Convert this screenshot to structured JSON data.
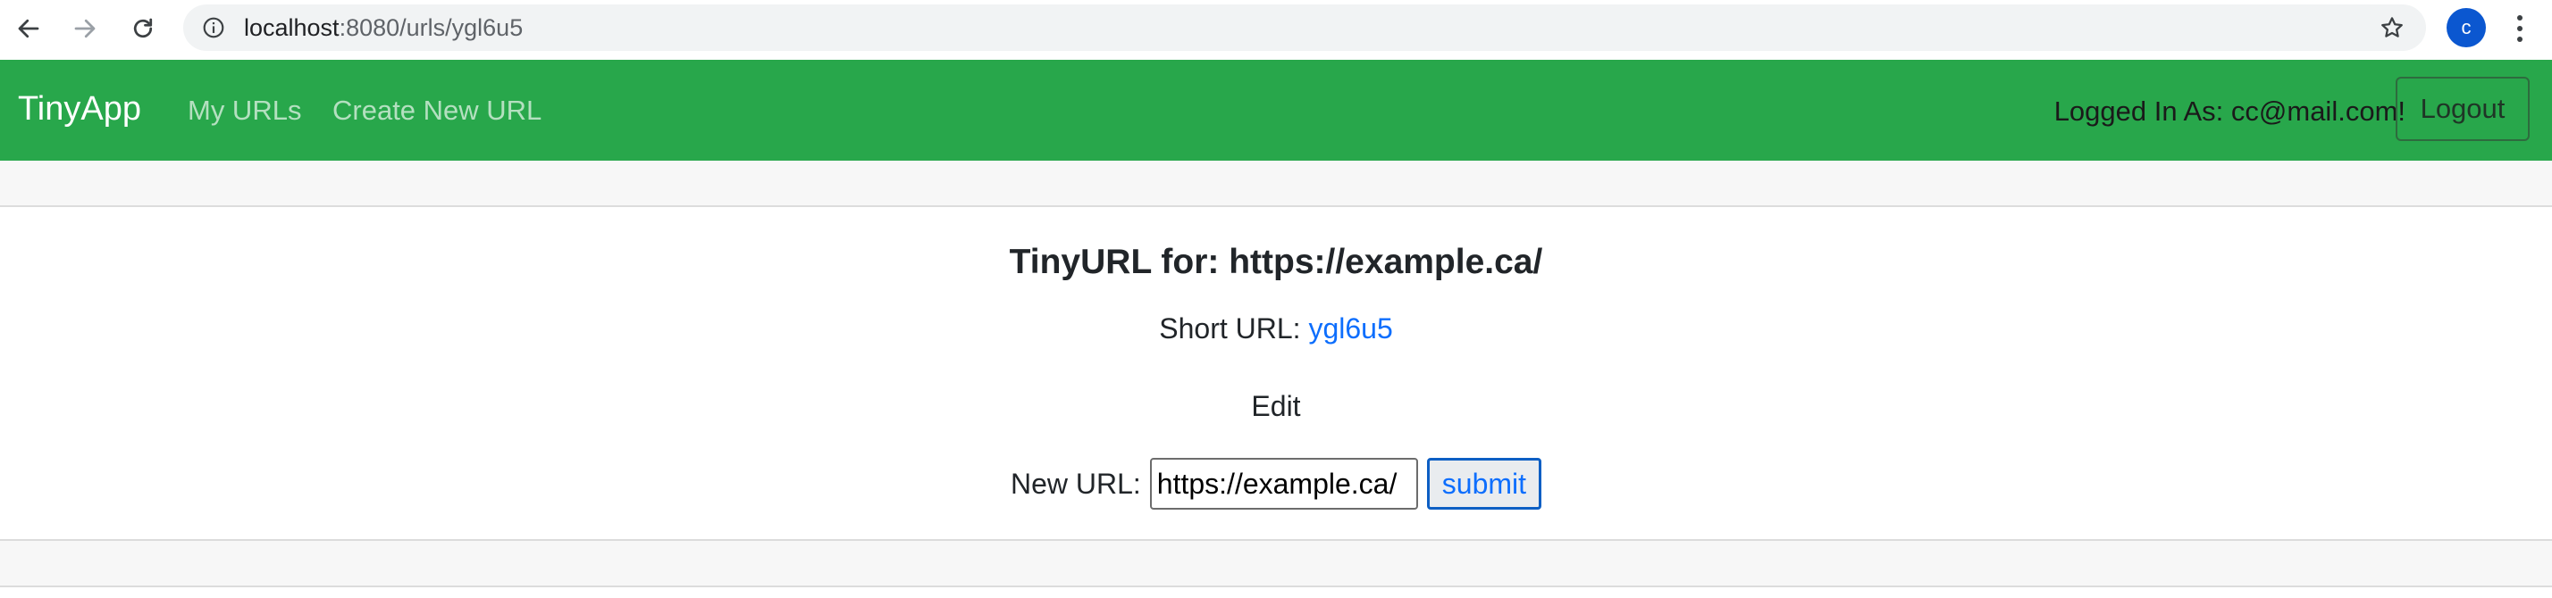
{
  "browser": {
    "url_host": "localhost",
    "url_rest": ":8080/urls/ygl6u5",
    "profile_initial": "c",
    "icons": {
      "back": "back-arrow-icon",
      "forward": "forward-arrow-icon",
      "reload": "reload-icon",
      "info": "info-icon",
      "bookmark": "star-icon",
      "menu": "kebab-menu-icon"
    }
  },
  "navbar": {
    "brand": "TinyApp",
    "links": [
      "My URLs",
      "Create New URL"
    ],
    "logged_in_text": "Logged In As: cc@mail.com!",
    "logout_label": "Logout",
    "bg_color": "#28a74b"
  },
  "main": {
    "title": "TinyURL for: https://example.ca/",
    "short_url_label": "Short URL: ",
    "short_url_value": "ygl6u5",
    "edit_heading": "Edit",
    "new_url_label": "New URL:",
    "new_url_value": "https://example.ca/",
    "submit_label": "submit"
  }
}
